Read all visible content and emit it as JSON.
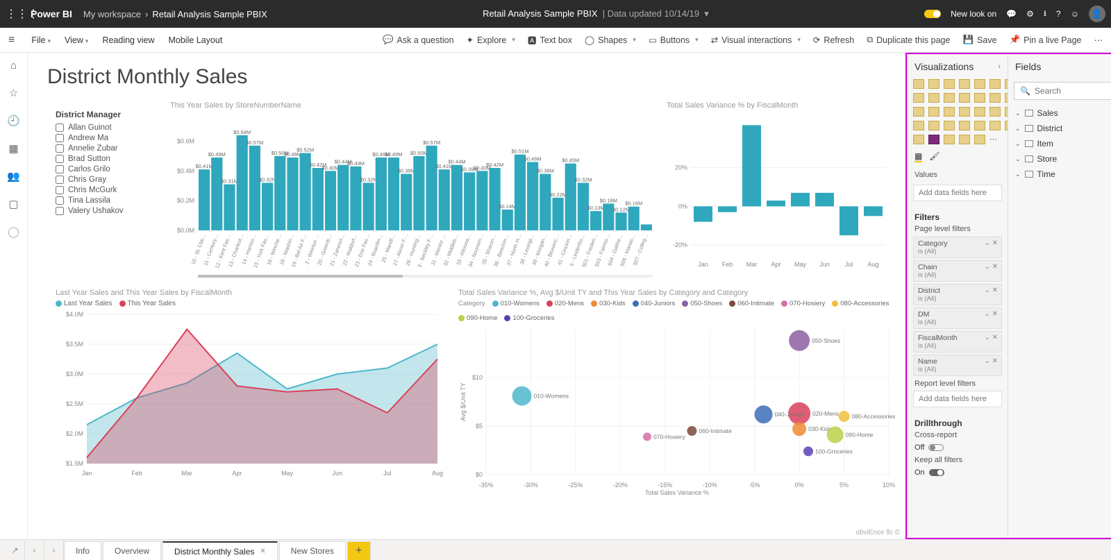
{
  "topbar": {
    "brand": "Power BI",
    "breadcrumb": [
      "My workspace",
      "Retail Analysis Sample PBIX"
    ],
    "center_title": "Retail Analysis Sample PBIX",
    "center_meta": "Data updated 10/14/19",
    "newlook_label": "New look on"
  },
  "toolbar": {
    "left": [
      "File",
      "View",
      "Reading view",
      "Mobile Layout"
    ],
    "right": [
      "Ask a question",
      "Explore",
      "Text box",
      "Shapes",
      "Buttons",
      "Visual interactions",
      "Refresh",
      "Duplicate this page",
      "Save",
      "Pin a live Page"
    ]
  },
  "page_title": "District Monthly Sales",
  "slicer": {
    "header": "District Manager",
    "items": [
      "Allan Guinot",
      "Andrew Ma",
      "Annelie Zubar",
      "Brad Sutton",
      "Carlos Grilo",
      "Chris Gray",
      "Chris McGurk",
      "Tina Lassila",
      "Valery Ushakov"
    ]
  },
  "tabs": [
    "Info",
    "Overview",
    "District Monthly Sales",
    "New Stores"
  ],
  "active_tab": 2,
  "viz_pane": {
    "title": "Visualizations",
    "values_label": "Values",
    "values_placeholder": "Add data fields here",
    "filters_label": "Filters",
    "page_filters_label": "Page level filters",
    "filters": [
      {
        "name": "Category",
        "state": "is (All)"
      },
      {
        "name": "Chain",
        "state": "is (All)"
      },
      {
        "name": "District",
        "state": "is (All)"
      },
      {
        "name": "DM",
        "state": "is (All)"
      },
      {
        "name": "FiscalMonth",
        "state": "is (All)"
      },
      {
        "name": "Name",
        "state": "is (All)"
      }
    ],
    "report_filters_label": "Report level filters",
    "report_filters_placeholder": "Add data fields here",
    "drill_label": "Drillthrough",
    "cross_label": "Cross-report",
    "off_label": "Off",
    "keep_label": "Keep all filters",
    "on_label": "On"
  },
  "fields_pane": {
    "title": "Fields",
    "search_placeholder": "Search",
    "tables": [
      "Sales",
      "District",
      "Item",
      "Store",
      "Time"
    ]
  },
  "credit": "obviEnce llc ©",
  "chart_data": [
    {
      "id": "bar_stores",
      "type": "bar",
      "title": "This Year Sales by StoreNumberName",
      "ylabel": "",
      "ylim": [
        0,
        0.7
      ],
      "yticks": [
        "$0.0M",
        "$0.2M",
        "$0.4M",
        "$0.6M"
      ],
      "categories": [
        "10 - St. Clai…",
        "11 - Century…",
        "12 - Kent Fas…",
        "13 - Charlest…",
        "14 - Harriso…",
        "15 - York Fas…",
        "16 - Winche…",
        "18 - Washin…",
        "19 - Bel Air F…",
        "2 - Weirton …",
        "20 - Greenb…",
        "21 - Zanesvi…",
        "22 - Waldorf…",
        "23 - Erie Fas…",
        "24 - Boardm…",
        "25 - Mandf…",
        "27 - Akron F…",
        "28 - Hunting…",
        "3 - Beckley F…",
        "31 - Mentor …",
        "32 - Middleb…",
        "33 - Altoona…",
        "34 - Noonsm…",
        "35 - Sharon…",
        "36 - Beechm…",
        "37 - North H…",
        "38 - Lexingt…",
        "39 - Morgan…",
        "40 - Beaverc…",
        "41 - Cincinn…",
        "5 - Lindenhu…",
        "501 - Frederi…",
        "503 - Fairmo…",
        "504 - Gaithe…",
        "506 - Manas…",
        "507 - Colleg…"
      ],
      "values": [
        0.41,
        0.49,
        0.31,
        0.64,
        0.57,
        0.32,
        0.5,
        0.49,
        0.52,
        0.42,
        0.4,
        0.44,
        0.43,
        0.32,
        0.49,
        0.49,
        0.38,
        0.5,
        0.57,
        0.41,
        0.44,
        0.39,
        0.4,
        0.42,
        0.14,
        0.51,
        0.46,
        0.38,
        0.22,
        0.45,
        0.32,
        0.13,
        0.18,
        0.12,
        0.16,
        0.04
      ],
      "data_labels": [
        "$0.41M",
        "$0.49M",
        "$0.31M",
        "$0.64M",
        "$0.57M",
        "$0.32N",
        "$0.50M",
        "$0.49M",
        "$0.52M",
        "$0.42M",
        "$0.40M",
        "$0.44M",
        "$0.43M",
        "$0.32N",
        "$0.49M",
        "$0.49M",
        "$0.38M",
        "$0.50M",
        "$0.57M",
        "$0.41M",
        "$0.44M",
        "$0.39M",
        "$0.40M",
        "$0.42M",
        "$0.14M",
        "$0.51M",
        "$0.46M",
        "$0.38M",
        "$0.22M",
        "$0.45M",
        "$0.32M",
        "$0.13M",
        "$0.18M",
        "$0.12M",
        "$0.16M",
        ""
      ]
    },
    {
      "id": "bar_variance",
      "type": "bar",
      "title": "Total Sales Variance % by FiscalMonth",
      "ylim": [
        -25,
        45
      ],
      "yticks": [
        "-20%",
        "0%",
        "20%"
      ],
      "categories": [
        "Jan",
        "Feb",
        "Mar",
        "Apr",
        "May",
        "Jun",
        "Jul",
        "Aug"
      ],
      "values": [
        -8,
        -3,
        42,
        3,
        7,
        7,
        -15,
        -5
      ]
    },
    {
      "id": "area_sales",
      "type": "area",
      "title": "Last Year Sales and This Year Sales by FiscalMonth",
      "legend": [
        "Last Year Sales",
        "This Year Sales"
      ],
      "colors": [
        "#4fb7c9",
        "#d9415b"
      ],
      "x": [
        "Jan",
        "Feb",
        "Mar",
        "Apr",
        "May",
        "Jun",
        "Jul",
        "Aug"
      ],
      "ylim": [
        1.5,
        4.0
      ],
      "yticks": [
        "$1.5M",
        "$2.0M",
        "$2.5M",
        "$3.0M",
        "$3.5M",
        "$4.0M"
      ],
      "series": [
        {
          "name": "Last Year Sales",
          "values": [
            2.15,
            2.6,
            2.85,
            3.35,
            2.75,
            3.0,
            3.1,
            3.5
          ]
        },
        {
          "name": "This Year Sales",
          "values": [
            1.6,
            2.6,
            3.75,
            2.8,
            2.7,
            2.75,
            2.35,
            3.25
          ]
        }
      ]
    },
    {
      "id": "scatter_cat",
      "type": "scatter",
      "title": "Total Sales Variance %, Avg $/Unit TY and This Year Sales by Category and Category",
      "xlabel": "Total Sales Variance %",
      "ylabel": "Avg $/Unit TY",
      "xlim": [
        -35,
        10
      ],
      "ylim": [
        0,
        15
      ],
      "xticks": [
        "-35%",
        "-30%",
        "-25%",
        "-20%",
        "-15%",
        "-10%",
        "-5%",
        "0%",
        "5%",
        "10%"
      ],
      "yticks": [
        "$0",
        "$5",
        "$10"
      ],
      "legend_title": "Category",
      "categories": [
        "010-Womens",
        "020-Mens",
        "030-Kids",
        "040-Juniors",
        "050-Shoes",
        "060-Intimate",
        "070-Hosiery",
        "080-Accessories",
        "090-Home",
        "100-Groceries"
      ],
      "colors": [
        "#4fb7c9",
        "#d9415b",
        "#f08a33",
        "#3b6fb6",
        "#8e5fa2",
        "#7a4a3a",
        "#d46fa8",
        "#f2c038",
        "#b8d14a",
        "#5a3fb6"
      ],
      "points": [
        {
          "name": "010-Womens",
          "x": -31,
          "y": 8.1,
          "size": 28
        },
        {
          "name": "020-Mens",
          "x": 0,
          "y": 6.3,
          "size": 32
        },
        {
          "name": "030-Kids",
          "x": 0,
          "y": 4.7,
          "size": 20
        },
        {
          "name": "040-Juniors",
          "x": -4,
          "y": 6.2,
          "size": 26
        },
        {
          "name": "050-Shoes",
          "x": 0,
          "y": 13.8,
          "size": 30
        },
        {
          "name": "060-Intimate",
          "x": -12,
          "y": 4.5,
          "size": 14
        },
        {
          "name": "070-Hosiery",
          "x": -17,
          "y": 3.9,
          "size": 12
        },
        {
          "name": "080-Accessories",
          "x": 5,
          "y": 6.0,
          "size": 16
        },
        {
          "name": "090-Home",
          "x": 4,
          "y": 4.1,
          "size": 24
        },
        {
          "name": "100-Groceries",
          "x": 1,
          "y": 2.4,
          "size": 14
        }
      ]
    }
  ]
}
